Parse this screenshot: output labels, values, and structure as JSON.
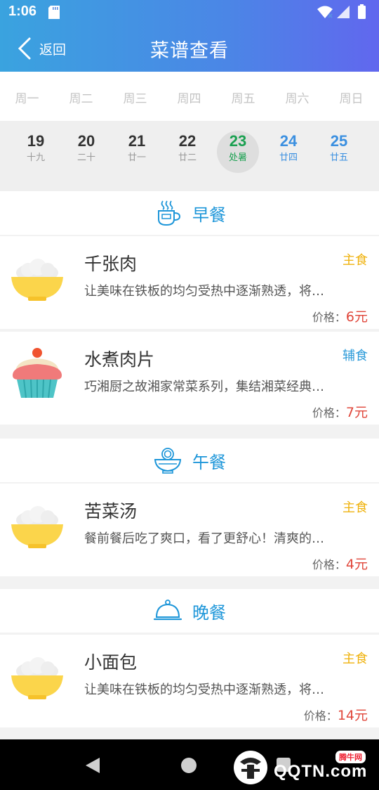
{
  "status": {
    "time": "1:06"
  },
  "header": {
    "back_label": "返回",
    "title": "菜谱查看"
  },
  "week": [
    "周一",
    "周二",
    "周三",
    "周四",
    "周五",
    "周六",
    "周日"
  ],
  "dates": [
    {
      "num": "19",
      "lunar": "十九",
      "state": "past"
    },
    {
      "num": "20",
      "lunar": "二十",
      "state": "past"
    },
    {
      "num": "21",
      "lunar": "廿一",
      "state": "past"
    },
    {
      "num": "22",
      "lunar": "廿二",
      "state": "past"
    },
    {
      "num": "23",
      "lunar": "处暑",
      "state": "selected"
    },
    {
      "num": "24",
      "lunar": "廿四",
      "state": "future"
    },
    {
      "num": "25",
      "lunar": "廿五",
      "state": "future"
    }
  ],
  "sections": {
    "breakfast": {
      "title": "早餐",
      "items": [
        {
          "name": "千张肉",
          "tag": "主食",
          "desc": "让美味在铁板的均匀受热中逐渐熟透，将…",
          "price_label": "价格：",
          "price": "6元",
          "icon": "rice-bowl-icon"
        },
        {
          "name": "水煮肉片",
          "tag": "辅食",
          "desc": "巧湘厨之故湘家常菜系列，集结湘菜经典…",
          "price_label": "价格：",
          "price": "7元",
          "icon": "cupcake-icon"
        }
      ]
    },
    "lunch": {
      "title": "午餐",
      "items": [
        {
          "name": "苦菜汤",
          "tag": "主食",
          "desc": "餐前餐后吃了爽口，看了更舒心！清爽的…",
          "price_label": "价格：",
          "price": "4元",
          "icon": "rice-bowl-icon"
        }
      ]
    },
    "dinner": {
      "title": "晚餐",
      "items": [
        {
          "name": "小面包",
          "tag": "主食",
          "desc": "让美味在铁板的均匀受热中逐渐熟透，将…",
          "price_label": "价格：",
          "price": "14元",
          "icon": "rice-bowl-icon"
        }
      ]
    }
  },
  "watermark": {
    "text": "QQTN.com",
    "badge": "腾牛网"
  },
  "colors": {
    "accent": "#1d96d9",
    "main_tag": "#efb20d",
    "side_tag": "#2b9ad9",
    "price": "#e0463a",
    "selected_date": "#1aa050"
  }
}
